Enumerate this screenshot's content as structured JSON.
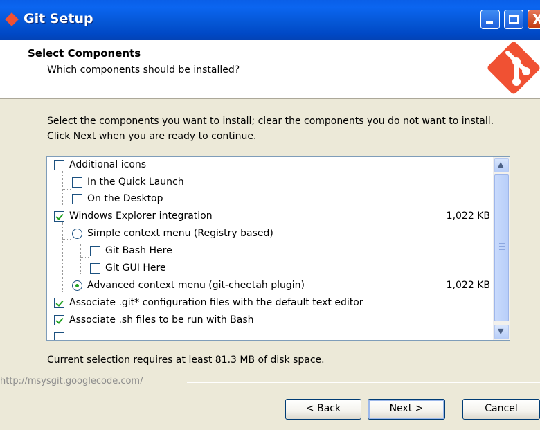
{
  "window": {
    "title": "Git Setup",
    "controls": {
      "minimize": "",
      "maximize": "",
      "close": "X"
    }
  },
  "header": {
    "title": "Select Components",
    "subtitle": "Which components should be installed?"
  },
  "instructions": "Select the components you want to install; clear the components you do not want to install. Click Next when you are ready to continue.",
  "components": [
    {
      "label": "Additional icons",
      "type": "checkbox",
      "checked": false,
      "size": ""
    },
    {
      "label": "In the Quick Launch",
      "type": "checkbox",
      "checked": false,
      "size": ""
    },
    {
      "label": "On the Desktop",
      "type": "checkbox",
      "checked": false,
      "size": ""
    },
    {
      "label": "Windows Explorer integration",
      "type": "checkbox",
      "checked": true,
      "size": "1,022 KB"
    },
    {
      "label": "Simple context menu (Registry based)",
      "type": "radio",
      "checked": false,
      "size": ""
    },
    {
      "label": "Git Bash Here",
      "type": "checkbox",
      "checked": false,
      "size": ""
    },
    {
      "label": "Git GUI Here",
      "type": "checkbox",
      "checked": false,
      "size": ""
    },
    {
      "label": "Advanced context menu (git-cheetah plugin)",
      "type": "radio",
      "checked": true,
      "size": "1,022 KB"
    },
    {
      "label": "Associate .git* configuration files with the default text editor",
      "type": "checkbox",
      "checked": true,
      "size": ""
    },
    {
      "label": "Associate .sh files to be run with Bash",
      "type": "checkbox",
      "checked": true,
      "size": ""
    }
  ],
  "disk_requirement": "Current selection requires at least 81.3 MB of disk space.",
  "url": "http://msysgit.googlecode.com/",
  "buttons": {
    "back": "< Back",
    "next": "Next >",
    "cancel": "Cancel"
  },
  "colors": {
    "titlebar": "#0557D6",
    "git_logo": "#F05133",
    "checkmark": "#21A121",
    "background": "#ECE9D8"
  },
  "icons": {
    "title": "git-logo-icon",
    "header": "git-logo-icon"
  }
}
